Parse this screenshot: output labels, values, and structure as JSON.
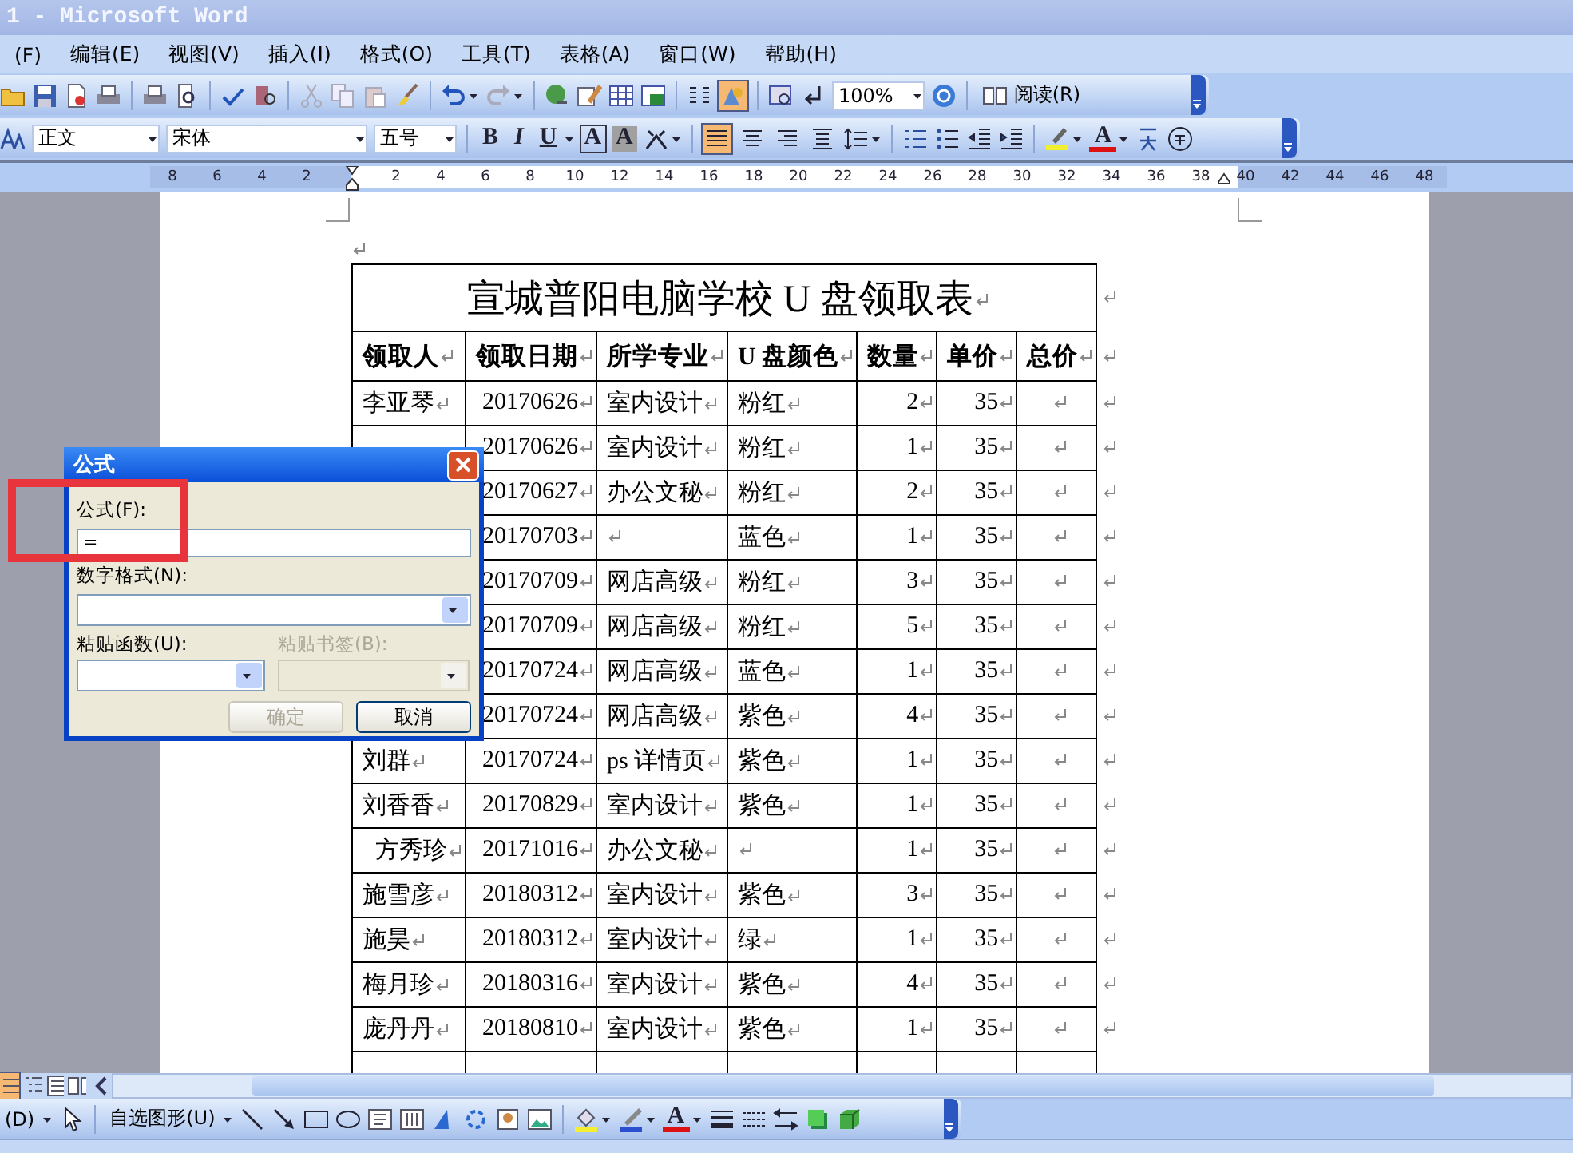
{
  "window": {
    "title": "1 - Microsoft Word"
  },
  "menu": [
    "(F)",
    "编辑(E)",
    "视图(V)",
    "插入(I)",
    "格式(O)",
    "工具(T)",
    "表格(A)",
    "窗口(W)",
    "帮助(H)"
  ],
  "standard_toolbar": {
    "drawing_button": {
      "on": true
    },
    "zoom": "100%",
    "read_button": "阅读(R)"
  },
  "formatting_toolbar": {
    "style": "正文",
    "font": "宋体",
    "size": "五号",
    "bold": "B",
    "italic": "I",
    "underline": "U",
    "char_border": "A",
    "char_shading": "A",
    "alignment_buttons": [
      {
        "selected": true
      },
      {
        "selected": false
      },
      {
        "selected": false
      },
      {
        "selected": false
      }
    ],
    "font_color": "A"
  },
  "ruler": {
    "left_ticks": [
      "8",
      "6",
      "4",
      "2"
    ],
    "right_ticks": [
      "2",
      "4",
      "6",
      "8",
      "10",
      "12",
      "14",
      "16",
      "18",
      "20",
      "22",
      "24",
      "26",
      "28",
      "30",
      "32",
      "34",
      "36",
      "38",
      "40",
      "42",
      "44",
      "46",
      "48"
    ]
  },
  "table": {
    "title": "宣城普阳电脑学校 U 盘领取表",
    "columns": [
      "领取人",
      "领取日期",
      "所学专业",
      "U 盘颜色",
      "数量",
      "单价",
      "总价"
    ],
    "rows": [
      {
        "name": "李亚琴",
        "indented": false,
        "date": "20170626",
        "major": "室内设计",
        "u_disk_color": "粉红",
        "qty": "2",
        "price": "35"
      },
      {
        "date": "20170626",
        "major": "室内设计",
        "u_disk_color": "粉红",
        "qty": "1",
        "price": "35"
      },
      {
        "date": "20170627",
        "major": "办公文秘",
        "u_disk_color": "粉红",
        "qty": "2",
        "price": "35"
      },
      {
        "date": "20170703",
        "u_disk_color": "蓝色",
        "qty": "1",
        "price": "35"
      },
      {
        "date": "20170709",
        "major": "网店高级",
        "u_disk_color": "粉红",
        "qty": "3",
        "price": "35"
      },
      {
        "date": "20170709",
        "major": "网店高级",
        "u_disk_color": "粉红",
        "qty": "5",
        "price": "35"
      },
      {
        "date": "20170724",
        "major": "网店高级",
        "u_disk_color": "蓝色",
        "qty": "1",
        "price": "35"
      },
      {
        "date": "20170724",
        "major": "网店高级",
        "u_disk_color": "紫色",
        "qty": "4",
        "price": "35"
      },
      {
        "name": "刘群",
        "indented": false,
        "date": "20170724",
        "major": "ps 详情页",
        "u_disk_color": "紫色",
        "qty": "1",
        "price": "35"
      },
      {
        "name": "刘香香",
        "indented": false,
        "date": "20170829",
        "major": "室内设计",
        "u_disk_color": "紫色",
        "qty": "1",
        "price": "35"
      },
      {
        "name": "方秀珍",
        "indented": true,
        "date": "20171016",
        "major": "办公文秘",
        "qty": "1",
        "price": "35"
      },
      {
        "name": "施雪彦",
        "indented": false,
        "date": "20180312",
        "major": "室内设计",
        "u_disk_color": "紫色",
        "qty": "3",
        "price": "35"
      },
      {
        "name": "施昊",
        "indented": false,
        "date": "20180312",
        "major": "室内设计",
        "u_disk_color": "绿",
        "qty": "1",
        "price": "35"
      },
      {
        "name": "梅月珍",
        "indented": false,
        "date": "20180316",
        "major": "室内设计",
        "u_disk_color": "紫色",
        "qty": "4",
        "price": "35"
      },
      {
        "name": "庞丹丹",
        "indented": false,
        "date": "20180810",
        "major": "室内设计",
        "u_disk_color": "紫色",
        "qty": "1",
        "price": "35"
      }
    ]
  },
  "dialog": {
    "title": "公式",
    "formula_label": "公式(F):",
    "formula_value": "=",
    "number_format_label": "数字格式(N):",
    "paste_function_label": "粘贴函数(U):",
    "paste_bookmark": {
      "label": "粘贴书签(B):",
      "disabled": true
    },
    "ok_button": {
      "label": "确定",
      "disabled": true
    },
    "cancel_button": {
      "label": "取消",
      "disabled": false
    }
  },
  "drawing_toolbar": {
    "draw_menu": "(D)",
    "autoshapes": "自选图形(U)",
    "font_color": "A"
  }
}
